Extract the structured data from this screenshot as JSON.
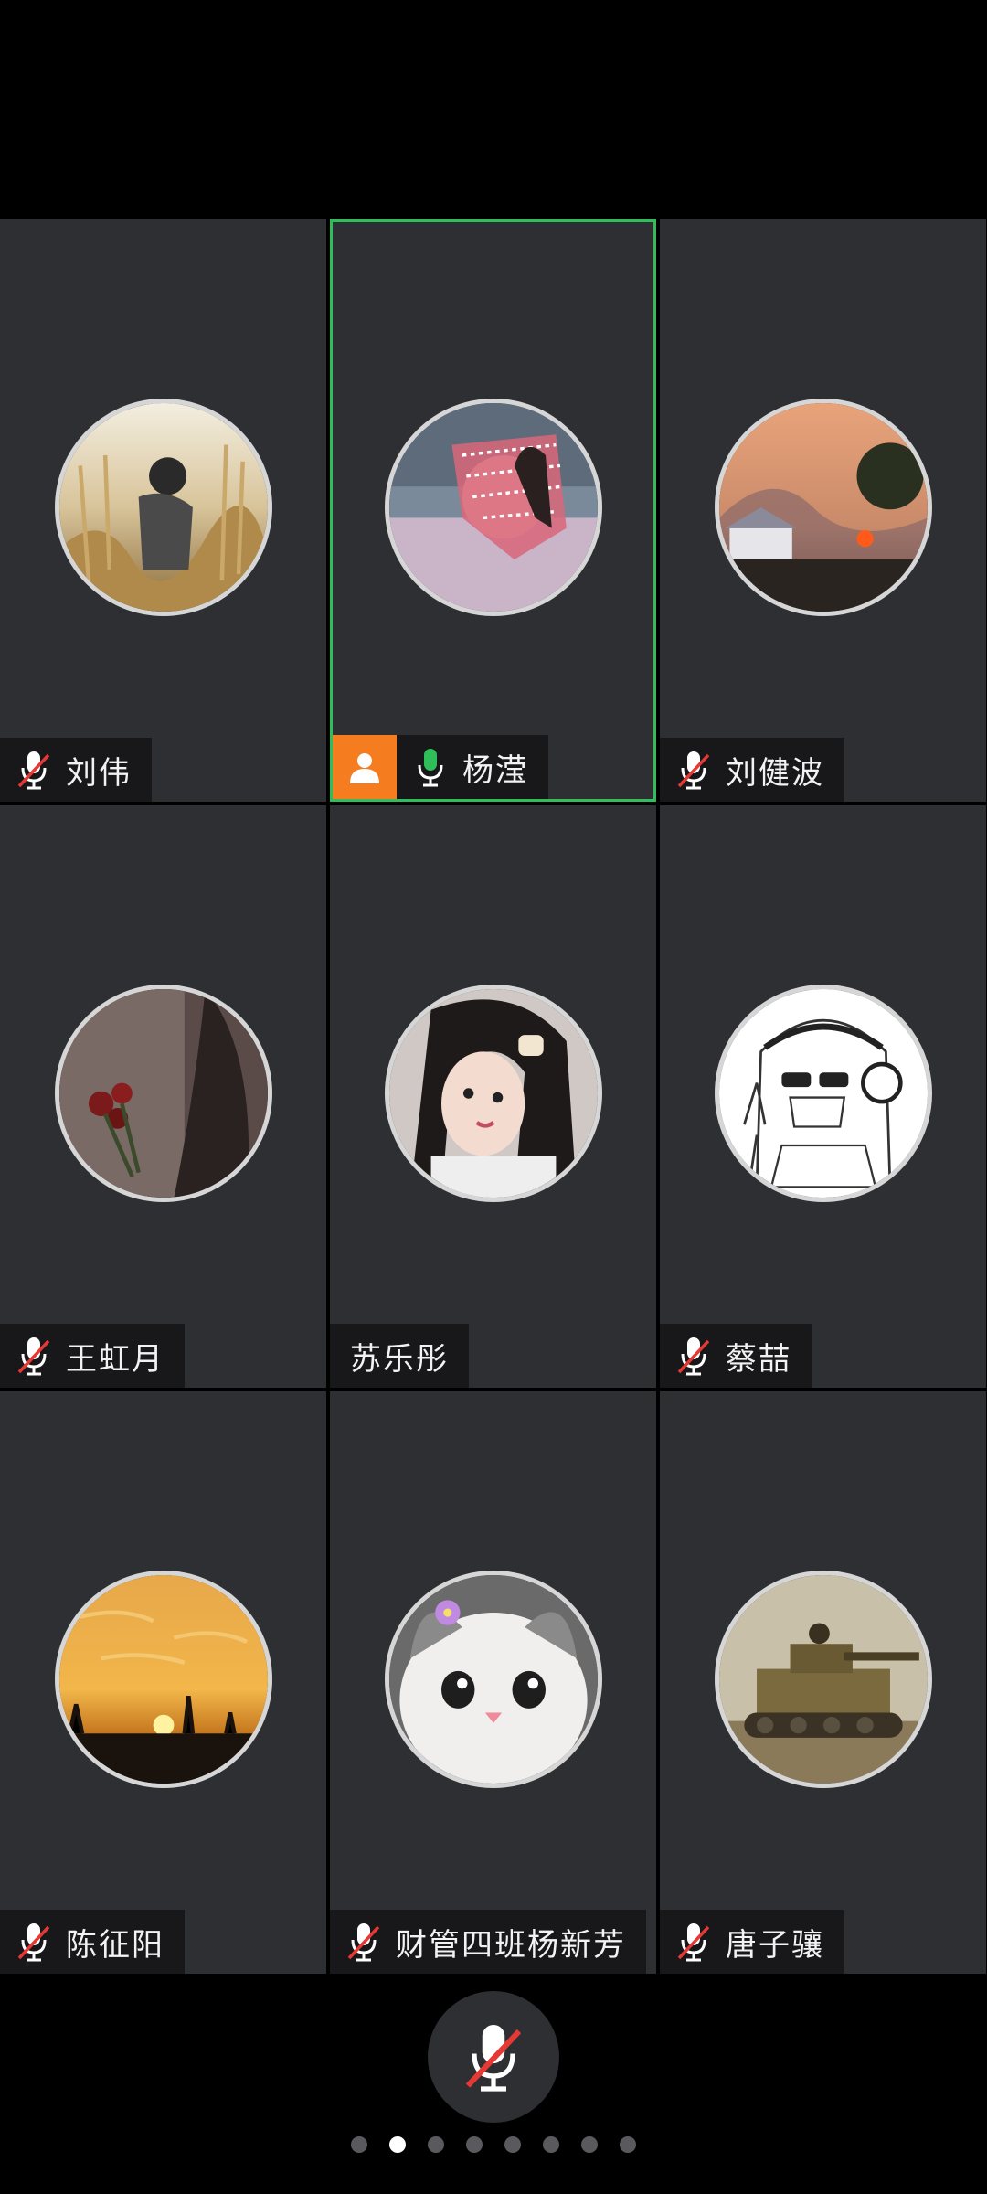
{
  "participants": [
    {
      "name": "刘伟",
      "mic": "muted",
      "host": false,
      "speaking": false
    },
    {
      "name": "杨滢",
      "mic": "on",
      "host": true,
      "speaking": true
    },
    {
      "name": "刘健波",
      "mic": "muted",
      "host": false,
      "speaking": false
    },
    {
      "name": "王虹月",
      "mic": "muted",
      "host": false,
      "speaking": false
    },
    {
      "name": "苏乐彤",
      "mic": "none",
      "host": false,
      "speaking": false
    },
    {
      "name": "蔡喆",
      "mic": "muted",
      "host": false,
      "speaking": false
    },
    {
      "name": "陈征阳",
      "mic": "muted",
      "host": false,
      "speaking": false
    },
    {
      "name": "财管四班杨新芳",
      "mic": "muted",
      "host": false,
      "speaking": false
    },
    {
      "name": "唐子骧",
      "mic": "muted",
      "host": false,
      "speaking": false
    }
  ],
  "colors": {
    "speaking_border": "#2fbf5a",
    "host_badge": "#f57c1f",
    "mic_on": "#2fbf5a",
    "mic_muted_slash": "#e53935"
  },
  "icons": {
    "host": "person-icon",
    "mic_on": "microphone-icon",
    "mic_muted": "microphone-muted-icon",
    "toggle": "microphone-muted-icon"
  },
  "pager": {
    "total": 8,
    "current": 2
  }
}
